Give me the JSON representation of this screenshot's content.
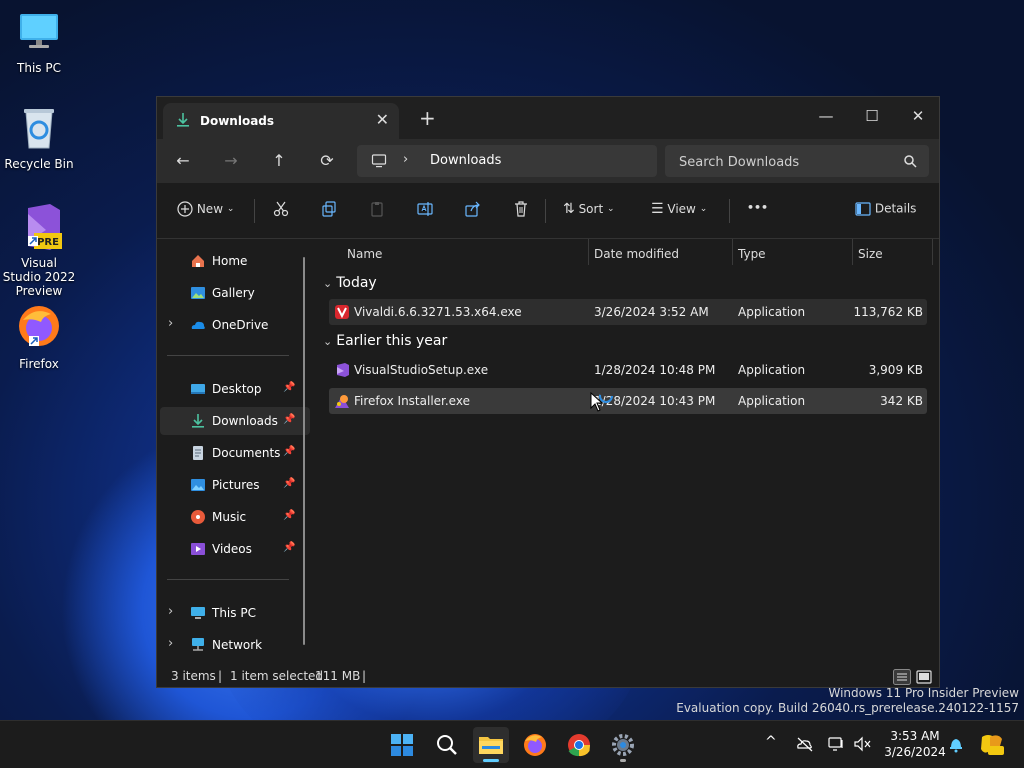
{
  "desktop": {
    "icons": [
      {
        "label": "This PC"
      },
      {
        "label": "Recycle Bin"
      },
      {
        "label": "Visual Studio 2022 Preview",
        "badge": "PRE"
      },
      {
        "label": "Firefox"
      }
    ],
    "watermark_line1": "Windows 11 Pro Insider Preview",
    "watermark_line2": "Evaluation copy. Build 26040.rs_prerelease.240122-1157"
  },
  "explorer": {
    "tab_title": "Downloads",
    "nav": {
      "back": "←",
      "forward": "→",
      "up": "↑",
      "refresh": "⟳"
    },
    "address": {
      "separator": "›",
      "crumb": "Downloads"
    },
    "search": {
      "placeholder": "Search Downloads"
    },
    "toolbar": {
      "new_label": "New",
      "sort_label": "Sort",
      "view_label": "View",
      "more_label": "•••",
      "details_label": "Details"
    },
    "sidebar": {
      "home": "Home",
      "gallery": "Gallery",
      "onedrive": "OneDrive",
      "desktop": "Desktop",
      "downloads": "Downloads",
      "documents": "Documents",
      "pictures": "Pictures",
      "music": "Music",
      "videos": "Videos",
      "thispc": "This PC",
      "network": "Network"
    },
    "columns": {
      "name": "Name",
      "date": "Date modified",
      "type": "Type",
      "size": "Size"
    },
    "groups": [
      {
        "label": "Today",
        "files": [
          {
            "name": "Vivaldi.6.6.3271.53.x64.exe",
            "date": "3/26/2024 3:52 AM",
            "type": "Application",
            "size": "113,762 KB",
            "icon": "vivaldi-icon"
          }
        ]
      },
      {
        "label": "Earlier this year",
        "files": [
          {
            "name": "VisualStudioSetup.exe",
            "date": "1/28/2024 10:48 PM",
            "type": "Application",
            "size": "3,909 KB",
            "icon": "visual-studio-icon"
          },
          {
            "name": "Firefox Installer.exe",
            "date": "1/28/2024 10:43 PM",
            "type": "Application",
            "size": "342 KB",
            "icon": "firefox-icon"
          }
        ]
      }
    ],
    "status": {
      "items": "3 items",
      "selected": "1 item selected",
      "size": "111 MB",
      "sep": "|"
    }
  },
  "taskbar": {
    "clock_time": "3:53 AM",
    "clock_date": "3/26/2024",
    "tray_chevron": "^"
  },
  "colors": {
    "accent": "#60cdff",
    "window_bg": "#1c1c1c",
    "folder_yellow": "#f4c542"
  }
}
